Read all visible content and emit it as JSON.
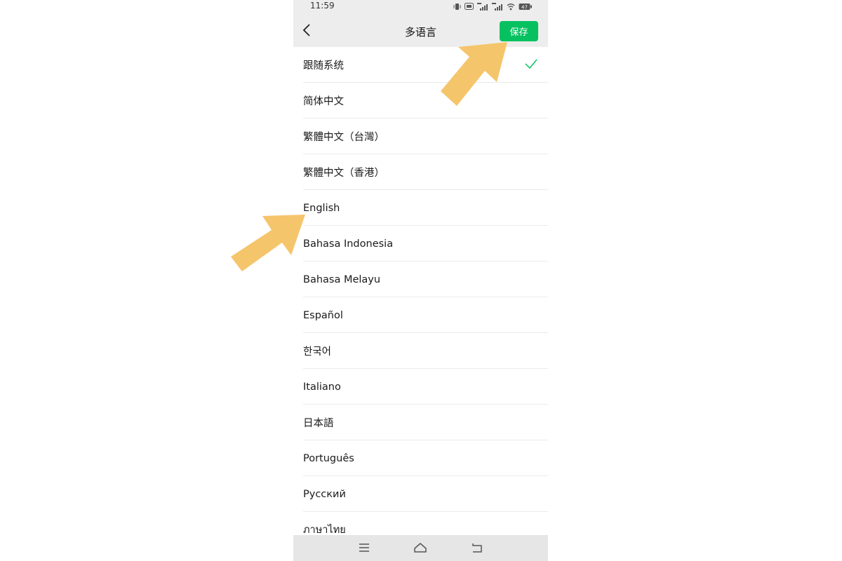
{
  "status_bar": {
    "time": "11:59",
    "battery": "47",
    "icons": [
      "vibrate-icon",
      "hd-icon",
      "signal-4g-icon",
      "signal-4g-icon",
      "wifi-icon",
      "battery-icon"
    ]
  },
  "header": {
    "title": "多语言",
    "save_label": "保存"
  },
  "languages": [
    {
      "label": "跟随系统",
      "selected": true
    },
    {
      "label": "简体中文",
      "selected": false
    },
    {
      "label": "繁體中文（台灣）",
      "selected": false
    },
    {
      "label": "繁體中文（香港）",
      "selected": false
    },
    {
      "label": "English",
      "selected": false
    },
    {
      "label": "Bahasa Indonesia",
      "selected": false
    },
    {
      "label": "Bahasa Melayu",
      "selected": false
    },
    {
      "label": "Español",
      "selected": false
    },
    {
      "label": "한국어",
      "selected": false
    },
    {
      "label": "Italiano",
      "selected": false
    },
    {
      "label": "日本語",
      "selected": false
    },
    {
      "label": "Português",
      "selected": false
    },
    {
      "label": "Русский",
      "selected": false
    },
    {
      "label": "ภาษาไทย",
      "selected": false
    }
  ],
  "system_nav": {
    "icons": [
      "menu-icon",
      "home-icon",
      "back-icon"
    ]
  },
  "annotations": {
    "arrow_color": "#f5c56b",
    "targets": [
      "save-button",
      "lang-item-english"
    ]
  },
  "colors": {
    "accent": "#07c160",
    "bar_background": "#ededed"
  }
}
